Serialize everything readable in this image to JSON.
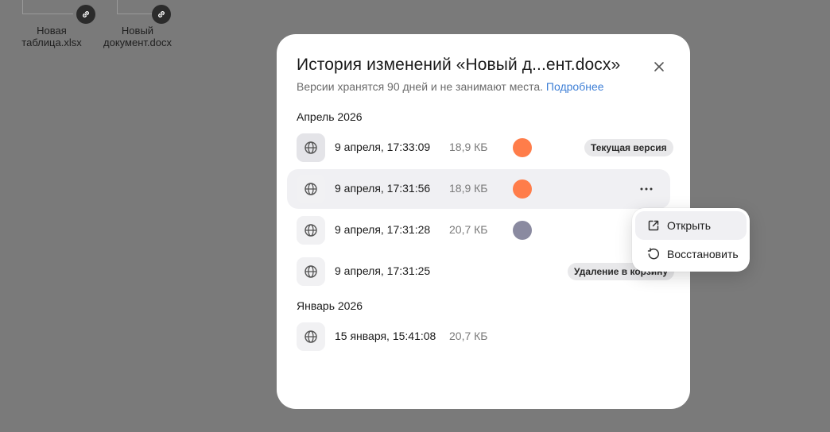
{
  "desktop": {
    "files": [
      {
        "name": "Новая таблица.xlsx",
        "line1": "Новая",
        "line2": "таблица.xlsx"
      },
      {
        "name": "Новый документ.docx",
        "line1": "Новый",
        "line2": "документ.docx"
      }
    ]
  },
  "modal": {
    "title": "История изменений «Новый д...ент.docx»",
    "subtitle": "Версии хранятся 90 дней и не занимают места.",
    "more_link": "Подробнее",
    "groups": [
      {
        "label": "Апрель 2026",
        "versions": [
          {
            "date": "9 апреля, 17:33:09",
            "size": "18,9 КБ",
            "avatar_color": "#ff7d4a",
            "badge": "Текущая версия"
          },
          {
            "date": "9 апреля, 17:31:56",
            "size": "18,9 КБ",
            "avatar_color": "#ff7d4a",
            "badge": ""
          },
          {
            "date": "9 апреля, 17:31:28",
            "size": "20,7 КБ",
            "avatar_color": "#8a8aa0",
            "badge": ""
          },
          {
            "date": "9 апреля, 17:31:25",
            "size": "",
            "avatar_color": "",
            "badge": "Удаление в корзину"
          }
        ]
      },
      {
        "label": "Январь 2026",
        "versions": [
          {
            "date": "15 января, 15:41:08",
            "size": "20,7 КБ",
            "avatar_color": "",
            "badge": ""
          }
        ]
      }
    ]
  },
  "context_menu": {
    "items": [
      {
        "label": "Открыть",
        "icon": "open-external-icon"
      },
      {
        "label": "Восстановить",
        "icon": "restore-icon"
      }
    ]
  },
  "colors": {
    "link": "#3e7fd6",
    "avatar_orange": "#ff7d4a",
    "avatar_gray": "#8a8aa0",
    "overlay": "#7a7a7a"
  }
}
